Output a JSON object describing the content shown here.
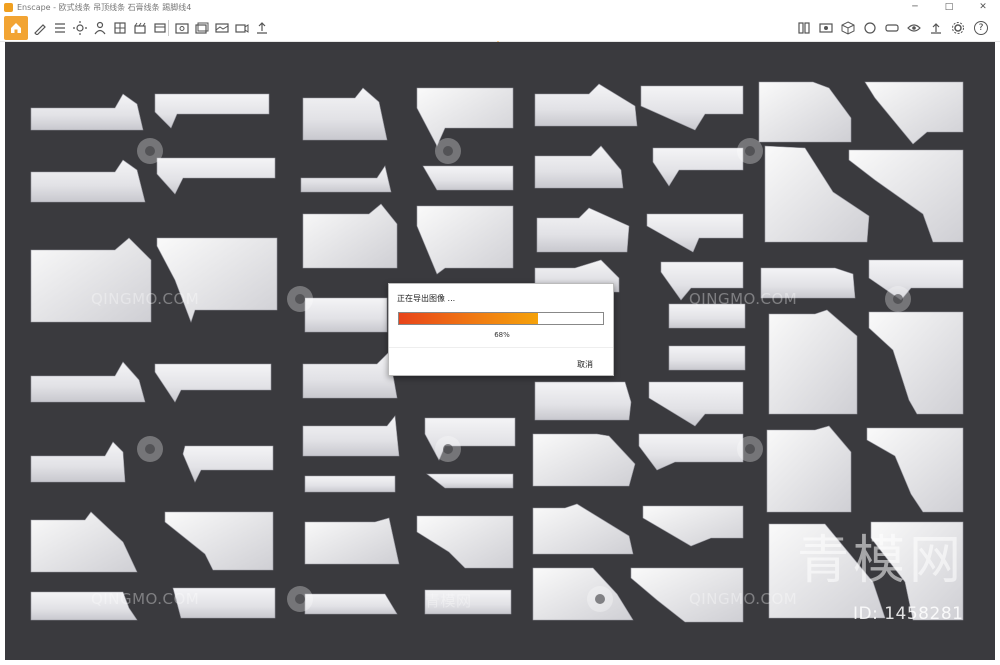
{
  "window": {
    "title": "Enscape - 欧式线条 吊顶线条 石膏线条 踢脚线4",
    "minimize_glyph": "─",
    "maximize_glyph": "□",
    "close_glyph": "✕"
  },
  "toolbar": {
    "home_icon": "home-icon",
    "help_glyph": "?",
    "accent": "#f2a433"
  },
  "dialog": {
    "title": "正在导出图像 ...",
    "progress_percent": 68,
    "progress_label": "68%",
    "cancel_label": "取消"
  },
  "watermark": {
    "site_text": "QINGMO.COM",
    "site_text_cn": "青模网",
    "big_text": "青模网",
    "id_text": "ID: 1458281"
  },
  "colors": {
    "viewport_bg": "#3a3a3e",
    "molding": "#e8e8ec"
  }
}
